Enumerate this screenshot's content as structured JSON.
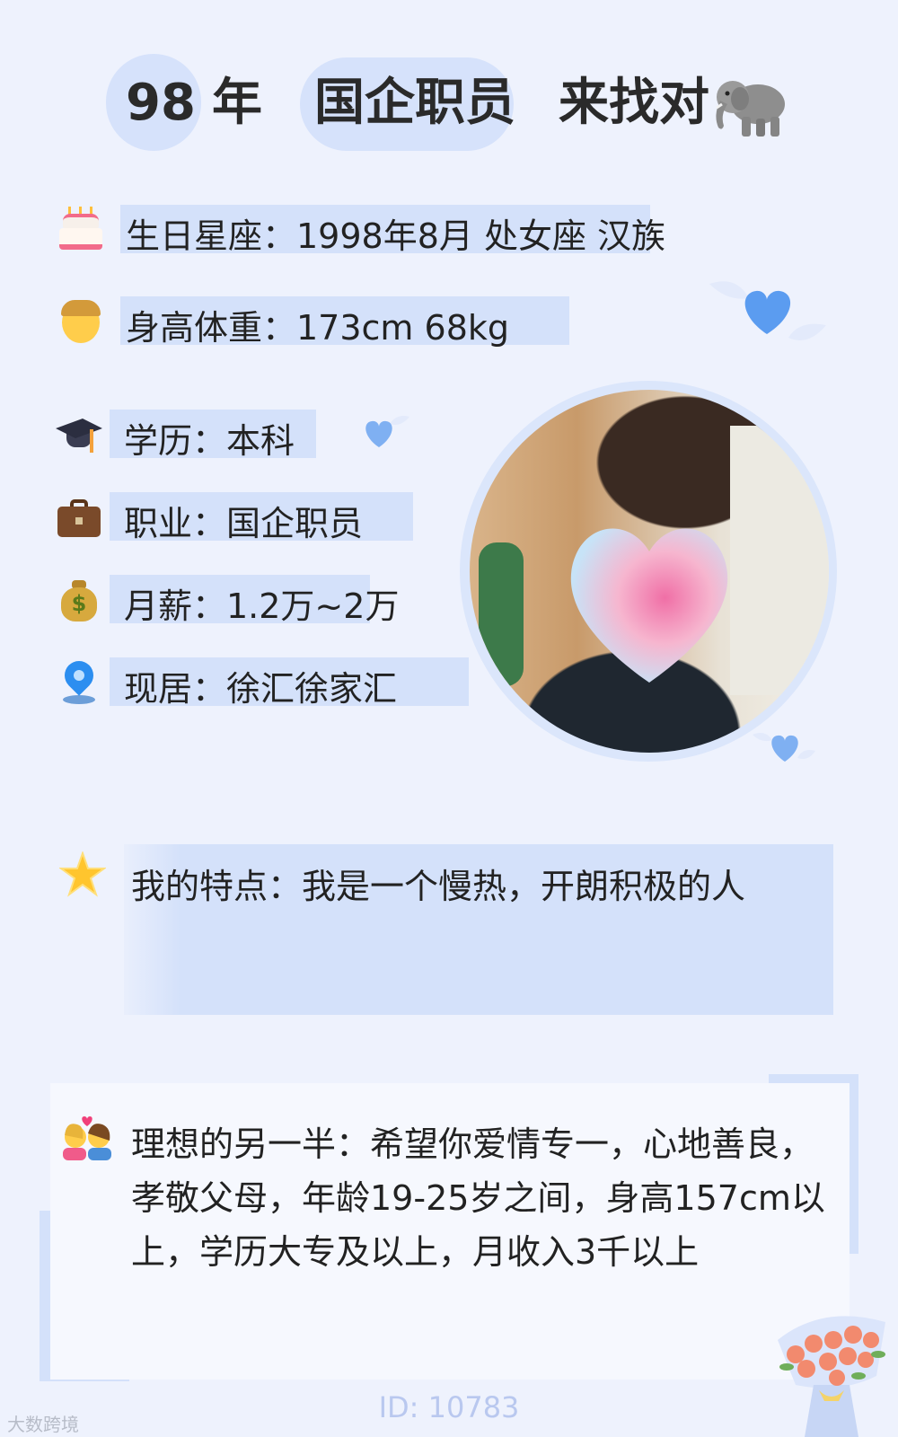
{
  "header": {
    "age": "98",
    "year_word": "年",
    "job": "国企职员",
    "seeking": "来找对",
    "seeking_icon": "elephant-icon"
  },
  "info": [
    {
      "icon": "birthday-cake-icon",
      "text": "生日星座：1998年8月 处女座 汉族"
    },
    {
      "icon": "man-face-icon",
      "text": "身高体重：173cm 68kg"
    },
    {
      "icon": "graduation-cap-icon",
      "text": "学历：本科"
    },
    {
      "icon": "briefcase-icon",
      "text": "职业：国企职员"
    },
    {
      "icon": "money-bag-icon",
      "text": "月薪：1.2万~2万"
    },
    {
      "icon": "location-pin-icon",
      "text": "现居：徐汇徐家汇"
    }
  ],
  "icons": {
    "money_bag_sign": "$"
  },
  "trait": {
    "icon": "star-icon",
    "text": "我的特点：我是一个慢热，开朗积极的人"
  },
  "ideal": {
    "icon": "couple-heart-icon",
    "text": "理想的另一半：希望你爱情专一，心地善良，孝敬父母，年龄19-25岁之间，身高157cm以上，学历大专及以上，月收入3千以上"
  },
  "footer": {
    "id": "ID: 10783",
    "watermark": "大数跨境"
  },
  "colors": {
    "background": "#eef2fd",
    "highlight": "#d4e1fa",
    "heart_blue": "#5b9cf0"
  }
}
